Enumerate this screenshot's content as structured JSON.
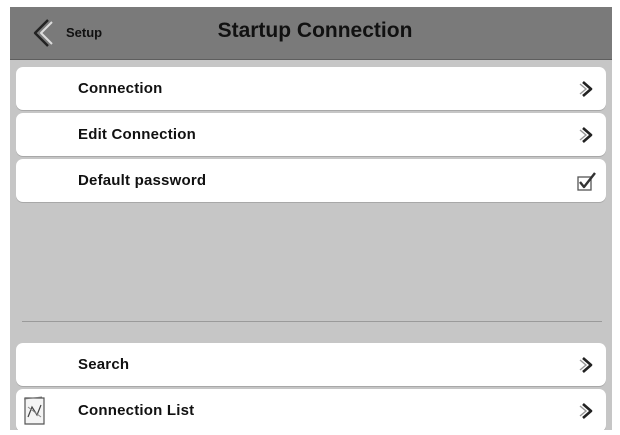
{
  "header": {
    "back_label": "Setup",
    "title": "Startup Connection"
  },
  "menu": {
    "items": [
      {
        "label": "Connection",
        "trailing_icon": "chevron-right-icon"
      },
      {
        "label": "Edit Connection",
        "trailing_icon": "chevron-right-icon"
      },
      {
        "label": "Default password",
        "trailing_icon": "checkmark-icon"
      }
    ]
  },
  "bottom_menu": {
    "items": [
      {
        "label": "Search",
        "trailing_icon": "chevron-right-icon"
      },
      {
        "label": "Connection List",
        "leading_icon": "connection-list-icon",
        "trailing_icon": "chevron-right-icon"
      }
    ]
  },
  "colors": {
    "header_bg": "#7a7a7a",
    "screen_bg": "#c6c6c6",
    "row_bg": "#ffffff"
  }
}
